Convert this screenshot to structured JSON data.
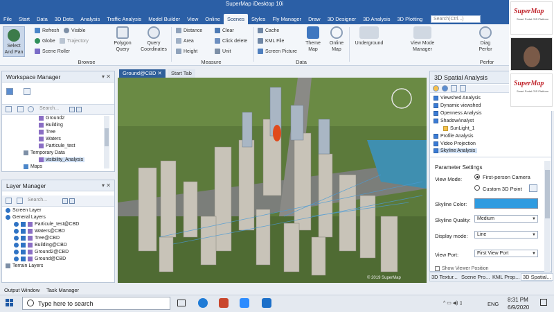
{
  "window": {
    "title": "SuperMap iDesktop 10i"
  },
  "menubar": {
    "items": [
      "File",
      "Start",
      "Data",
      "3D Data",
      "Analysis",
      "Traffic Analysis",
      "Model Builder",
      "View",
      "Online",
      "Scenes",
      "Styles",
      "Fly Manager",
      "Draw",
      "3D Designer",
      "3D Analysis",
      "3D Plotting"
    ],
    "active": "Scenes",
    "search_placeholder": "Search(Ctrl...)"
  },
  "ribbon": {
    "browse": {
      "select_label": "Select\nAnd Pan",
      "refresh": "Refresh",
      "visible": "Visible",
      "globe": "Globe",
      "trajectory": "Trajectory",
      "scene_roller": "Scene Roller",
      "polygon_query": "Polygon\nQuery",
      "query_coords": "Query\nCoordinates",
      "group": "Browse"
    },
    "measure": {
      "distance": "Distance",
      "clear": "Clear",
      "area": "Area",
      "click_delete": "Click delete",
      "height": "Height",
      "unit": "Unit",
      "group": "Measure"
    },
    "data": {
      "cache": "Cache",
      "kml_file": "KML File",
      "screen_picture": "Screen Picture",
      "theme_map": "Theme\nMap",
      "online_map": "Online\nMap",
      "group": "Data"
    },
    "underground": "Underground",
    "view_mode": "View Mode\nManager",
    "diag": "Diag\nPerfor",
    "perf_group": "Perfor"
  },
  "workspace": {
    "title": "Workspace Manager",
    "search_placeholder": "Search...",
    "items": [
      "Ground2",
      "Building",
      "Tree",
      "Waters",
      "Particule_test",
      "Temporary Data",
      "visibility_Analysis",
      "Maps"
    ]
  },
  "layers": {
    "title": "Layer Manager",
    "search_placeholder": "Search...",
    "items": [
      "Screen Layer",
      "General Layers",
      "Particule_test@CBD",
      "Waters@CBD",
      "Tree@CBD",
      "Building@CBD",
      "Ground2@CBD",
      "Ground@CBD",
      "Terrain Layers"
    ]
  },
  "doc_tabs": [
    "Ground@CBD",
    "Start Tab"
  ],
  "map": {
    "copyright": "© 2019 SuperMap"
  },
  "analysis": {
    "title": "3D Spatial Analysis",
    "items": [
      "Viewshed Analysis",
      "Dynamic viewshed",
      "Openness Analysis",
      "ShadowAnalyst",
      "SunLight_1",
      "Profile Analysis",
      "Video Projection",
      "Skyline Analysis"
    ],
    "params_title": "Parameter Settings",
    "view_mode_label": "View Mode:",
    "radio_first": "First-person Camera",
    "radio_custom": "Custom 3D Point",
    "skyline_color_label": "Skyline Color:",
    "skyline_color": "#2f9be0",
    "skyline_quality_label": "Skyline Quality:",
    "skyline_quality": "Medium",
    "display_mode_label": "Display mode:",
    "display_mode": "Line",
    "view_port_label": "View Port:",
    "view_port": "First View Port",
    "show_viewer_position": "Show Viewer Position"
  },
  "right_tabs": [
    "3D Textur...",
    "Scene Pro...",
    "KML Prop...",
    "3D Spatial..."
  ],
  "bottom_tabs": [
    "Output Window",
    "Task Manager"
  ],
  "taskbar": {
    "search_placeholder": "Type here to search",
    "time": "8:31 PM",
    "date": "6/9/2020",
    "lang": "ENG"
  },
  "video": {
    "logo": "SuperMap",
    "tagline": "Smart Portal GIS Platform"
  }
}
